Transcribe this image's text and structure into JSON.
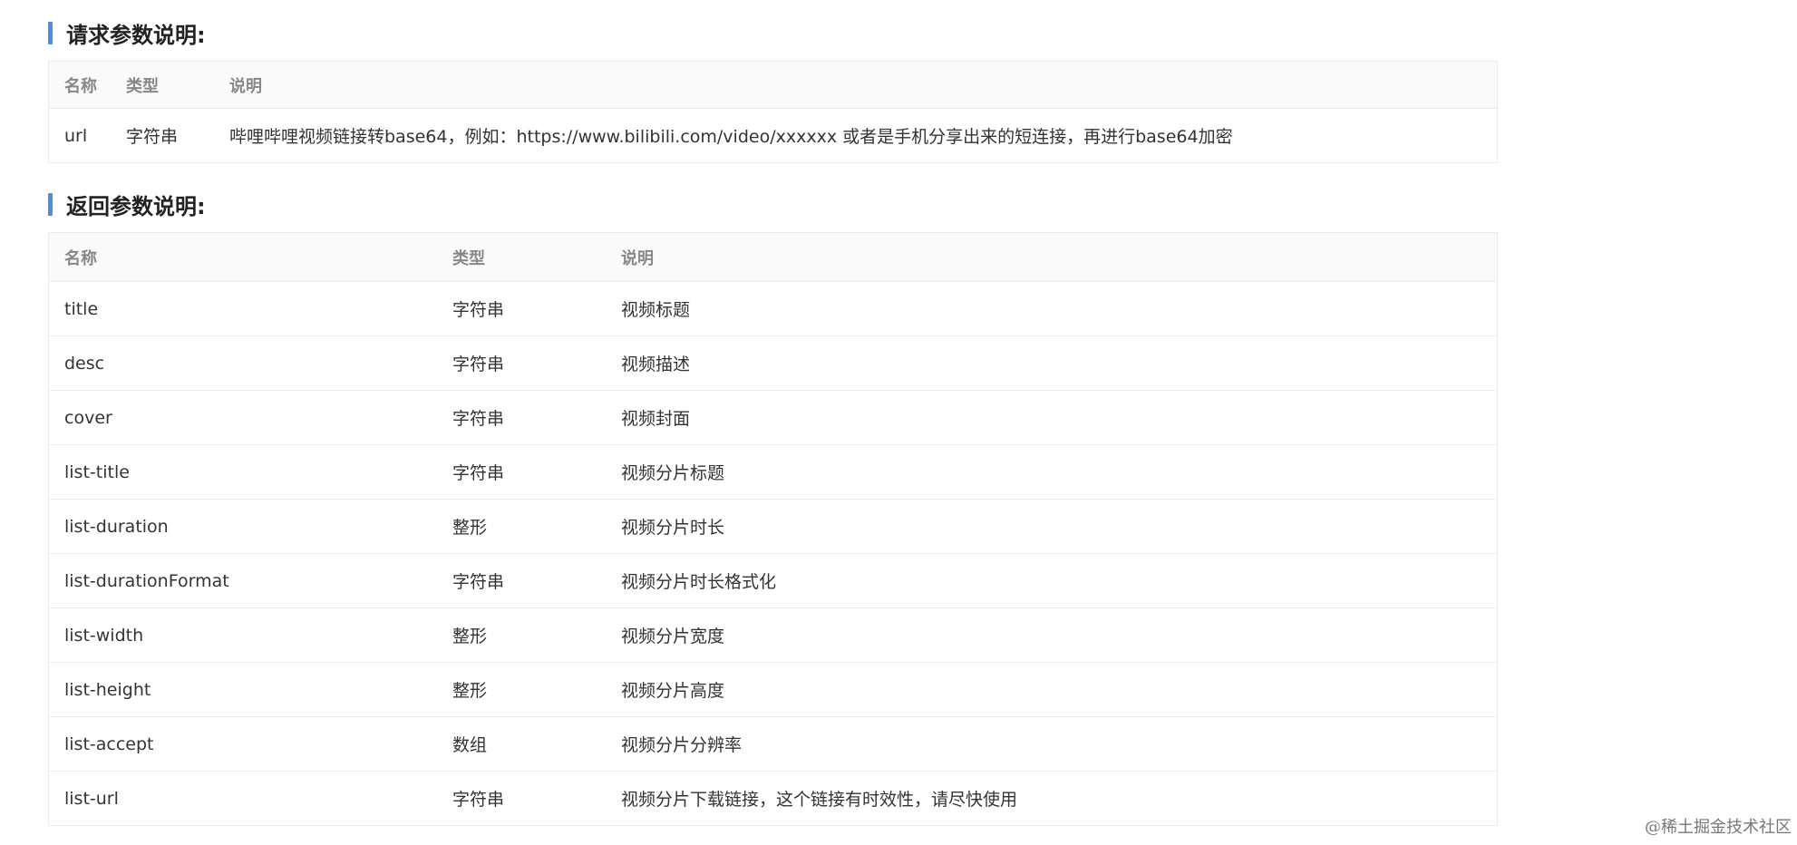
{
  "request_section": {
    "title": "请求参数说明:",
    "headers": [
      "名称",
      "类型",
      "说明"
    ],
    "rows": [
      [
        "url",
        "字符串",
        "哔哩哔哩视频链接转base64，例如：https://www.bilibili.com/video/xxxxxx 或者是手机分享出来的短连接，再进行base64加密"
      ]
    ]
  },
  "response_section": {
    "title": "返回参数说明:",
    "headers": [
      "名称",
      "类型",
      "说明"
    ],
    "rows": [
      [
        "title",
        "字符串",
        "视频标题"
      ],
      [
        "desc",
        "字符串",
        "视频描述"
      ],
      [
        "cover",
        "字符串",
        "视频封面"
      ],
      [
        "list-title",
        "字符串",
        "视频分片标题"
      ],
      [
        "list-duration",
        "整形",
        "视频分片时长"
      ],
      [
        "list-durationFormat",
        "字符串",
        "视频分片时长格式化"
      ],
      [
        "list-width",
        "整形",
        "视频分片宽度"
      ],
      [
        "list-height",
        "整形",
        "视频分片高度"
      ],
      [
        "list-accept",
        "数组",
        "视频分片分辨率"
      ],
      [
        "list-url",
        "字符串",
        "视频分片下载链接，这个链接有时效性，请尽快使用"
      ]
    ]
  },
  "watermark": "@稀土掘金技术社区",
  "colors": {
    "accent_bar": "#4a8ee0",
    "header_bg": "#fafafa",
    "border": "#ebebeb"
  }
}
